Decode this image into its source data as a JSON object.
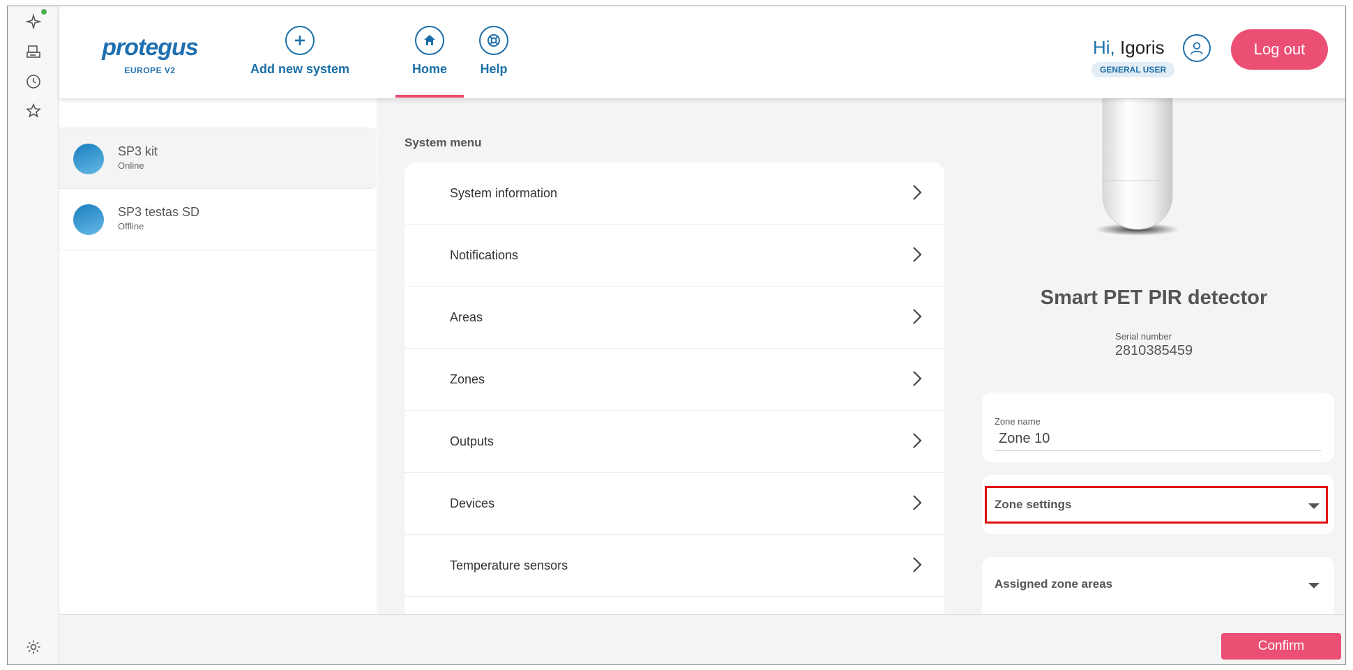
{
  "header": {
    "logo_word": "protegus",
    "logo_sub": "EUROPE V2",
    "nav": [
      {
        "label": "Add new system",
        "icon": "plus-circle-icon"
      },
      {
        "label": "Home",
        "icon": "home-icon"
      },
      {
        "label": "Help",
        "icon": "lifebuoy-icon"
      }
    ],
    "greeting_hi": "Hi,",
    "greeting_name": "Igoris",
    "role": "GENERAL USER",
    "logout_label": "Log out"
  },
  "systems": [
    {
      "name": "SP3 kit",
      "status": "Online",
      "selected": true
    },
    {
      "name": "SP3 testas SD",
      "status": "Offline",
      "selected": false
    }
  ],
  "system_menu": {
    "title": "System menu",
    "items": [
      "System information",
      "Notifications",
      "Areas",
      "Zones",
      "Outputs",
      "Devices",
      "Temperature sensors"
    ]
  },
  "device": {
    "title": "Smart PET PIR detector",
    "serial_label": "Serial number",
    "serial_value": "2810385459",
    "zone_name_label": "Zone name",
    "zone_name_value": "Zone 10",
    "accordions": [
      "Zone settings",
      "Assigned zone areas"
    ]
  },
  "footer": {
    "confirm_label": "Confirm"
  },
  "colors": {
    "brand_blue": "#1a6fa8",
    "accent_pink": "#ec4f74",
    "highlight_red": "#e01010",
    "online_dot": "#4caf50"
  }
}
